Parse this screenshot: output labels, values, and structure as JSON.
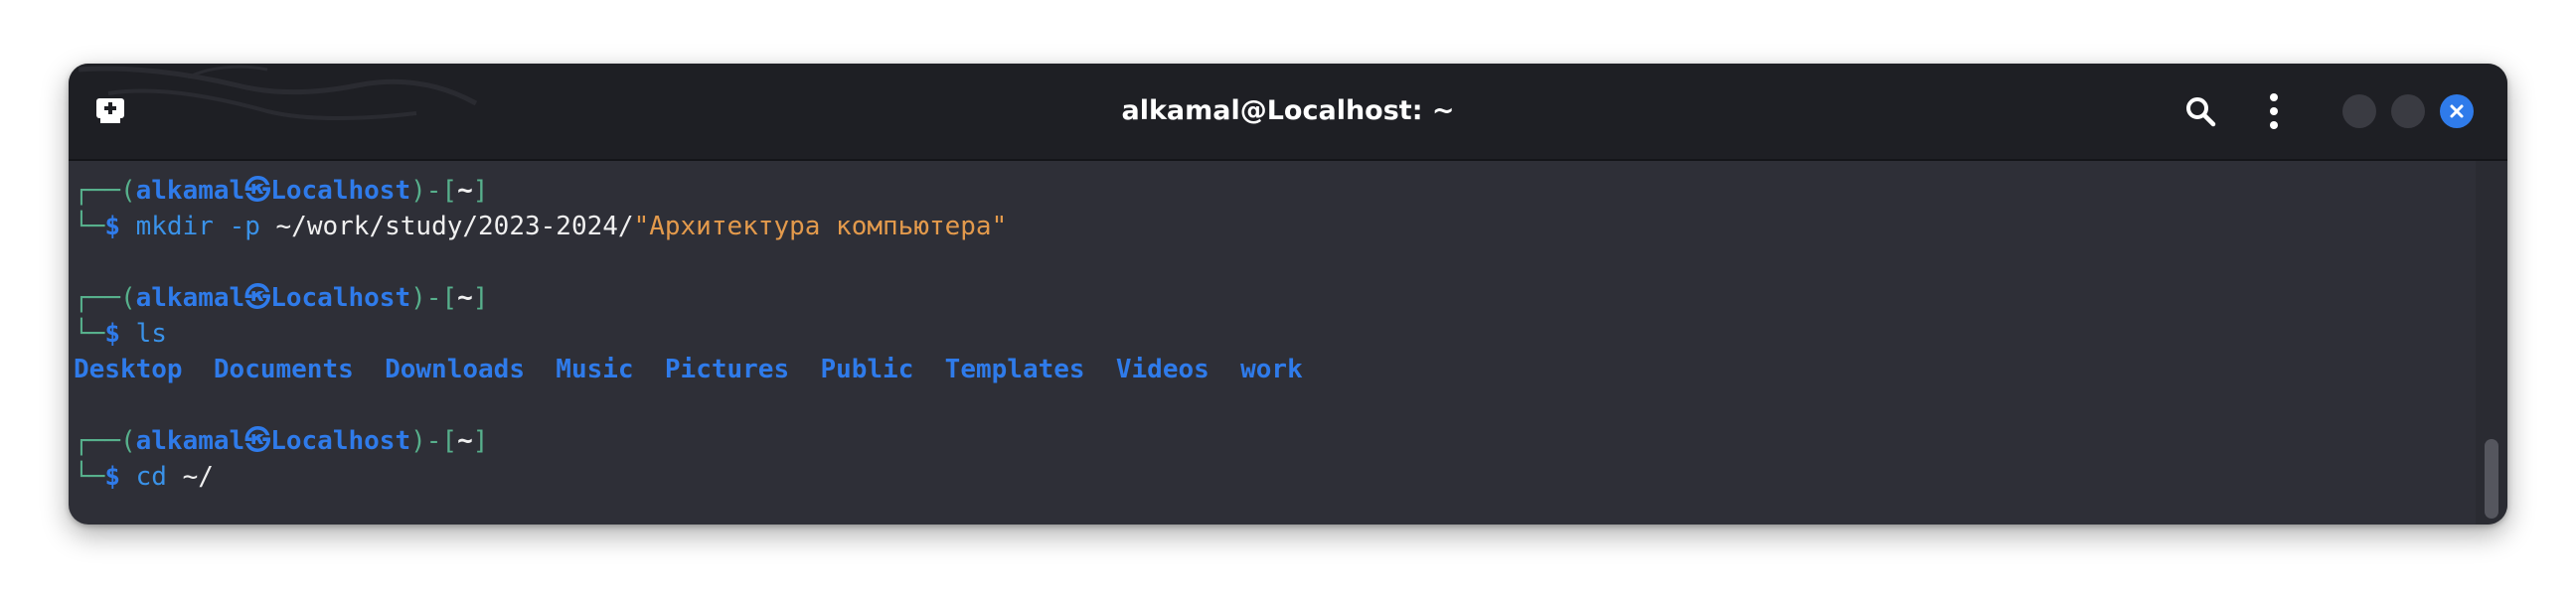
{
  "window": {
    "title": "alkamal@Localhost: ~"
  },
  "icons": {
    "new_tab": "new-tab-icon",
    "search": "search-icon",
    "menu": "kebab-menu-icon",
    "close": "close-icon"
  },
  "colors": {
    "titlebar": "#1e1f24",
    "terminal_bg": "#2e2f37",
    "prompt_frame": "#57b08c",
    "user_host": "#2f7bea",
    "string": "#e39a4c",
    "command": "#3a92e8",
    "close_button": "#2f7bea"
  },
  "terminal": {
    "prompt": {
      "corner_top": "┌──(",
      "user": "alkamal",
      "at_symbol": "㉿",
      "host": "Localhost",
      "mid": ")-[",
      "cwd": "~",
      "end": "]",
      "corner_bottom": "└─",
      "dollar": "$"
    },
    "commands": [
      {
        "cmd": "mkdir",
        "flag": "-p",
        "path": "~/work/study/2023-2024/",
        "arg_string": "\"Архитектура компьютера\""
      },
      {
        "cmd": "ls"
      },
      {
        "cmd": "cd",
        "arg": "~/"
      }
    ],
    "ls_output": [
      "Desktop",
      "Documents",
      "Downloads",
      "Music",
      "Pictures",
      "Public",
      "Templates",
      "Videos",
      "work"
    ]
  }
}
